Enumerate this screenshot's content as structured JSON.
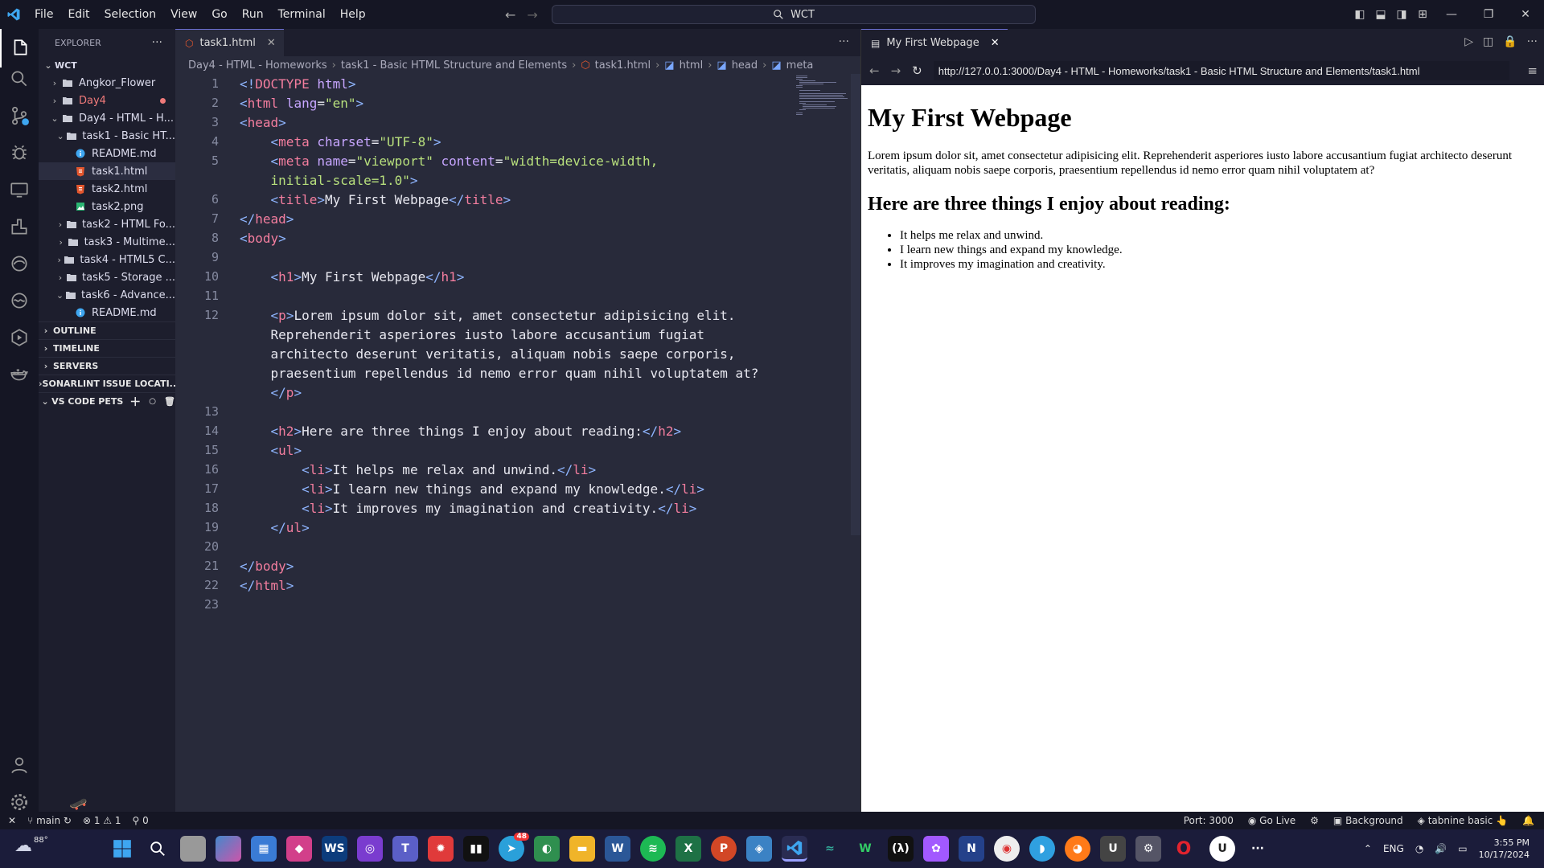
{
  "menu": [
    "File",
    "Edit",
    "Selection",
    "View",
    "Go",
    "Run",
    "Terminal",
    "Help"
  ],
  "search": {
    "text": "WCT"
  },
  "explorer": {
    "header": "EXPLORER",
    "root": "WCT",
    "items": [
      {
        "label": "Angkor_Flower",
        "indent": 1,
        "type": "folder",
        "chev": "›"
      },
      {
        "label": "Day4",
        "indent": 1,
        "type": "folder",
        "chev": "›",
        "color": "#f07a7a"
      },
      {
        "label": "Day4 - HTML - H...",
        "indent": 1,
        "type": "folder-open",
        "chev": "⌄"
      },
      {
        "label": "task1 - Basic HT...",
        "indent": 2,
        "type": "folder-open",
        "chev": "⌄"
      },
      {
        "label": "README.md",
        "indent": 3,
        "type": "info"
      },
      {
        "label": "task1.html",
        "indent": 3,
        "type": "html",
        "selected": true
      },
      {
        "label": "task2.html",
        "indent": 3,
        "type": "html"
      },
      {
        "label": "task2.png",
        "indent": 3,
        "type": "image"
      },
      {
        "label": "task2 - HTML Fo...",
        "indent": 2,
        "type": "folder",
        "chev": "›"
      },
      {
        "label": "task3 - Multime...",
        "indent": 2,
        "type": "folder",
        "chev": "›"
      },
      {
        "label": "task4 - HTML5 C...",
        "indent": 2,
        "type": "folder",
        "chev": "›"
      },
      {
        "label": "task5 - Storage ...",
        "indent": 2,
        "type": "folder",
        "chev": "›"
      },
      {
        "label": "task6 - Advance...",
        "indent": 2,
        "type": "folder-open",
        "chev": "⌄"
      },
      {
        "label": "README.md",
        "indent": 3,
        "type": "info"
      }
    ],
    "sections": [
      "OUTLINE",
      "TIMELINE",
      "SERVERS",
      "SONARLINT ISSUE LOCATI...",
      "VS CODE PETS"
    ]
  },
  "editor": {
    "tab": "task1.html",
    "breadcrumbs": [
      "Day4 - HTML - Homeworks",
      "task1 - Basic HTML Structure and Elements",
      "task1.html",
      "html",
      "head",
      "meta"
    ],
    "lines": [
      {
        "n": "1",
        "h": "<span class=b>&lt;!</span><span class=t>DOCTYPE</span> <span class=a>html</span><span class=b>&gt;</span>"
      },
      {
        "n": "2",
        "h": "<span class=b>&lt;</span><span class=t>html</span> <span class=a>lang</span>=<span class=s>\"en\"</span><span class=b>&gt;</span>"
      },
      {
        "n": "3",
        "h": "<span class=b>&lt;</span><span class=t>head</span><span class=b>&gt;</span>"
      },
      {
        "n": "4",
        "h": "    <span class=b>&lt;</span><span class=t>meta</span> <span class=a>charset</span>=<span class=s>\"UTF-8\"</span><span class=b>&gt;</span>"
      },
      {
        "n": "5",
        "h": "    <span class=b>&lt;</span><span class=t>meta</span> <span class=a>name</span>=<span class=s>\"viewport\"</span> <span class=a>content</span>=<span class=s>\"width=device-width,</span>"
      },
      {
        "n": "",
        "h": "    <span class=s>initial-scale=1.0\"</span><span class=b>&gt;</span>"
      },
      {
        "n": "6",
        "h": "    <span class=b>&lt;</span><span class=t>title</span><span class=b>&gt;</span>My First Webpage<span class=b>&lt;/</span><span class=t>title</span><span class=b>&gt;</span>"
      },
      {
        "n": "7",
        "h": "<span class=b>&lt;/</span><span class=t>head</span><span class=b>&gt;</span>"
      },
      {
        "n": "8",
        "h": "<span class=b>&lt;</span><span class=t>body</span><span class=b>&gt;</span>"
      },
      {
        "n": "9",
        "h": ""
      },
      {
        "n": "10",
        "h": "    <span class=b>&lt;</span><span class=t>h1</span><span class=b>&gt;</span>My First Webpage<span class=b>&lt;/</span><span class=t>h1</span><span class=b>&gt;</span>"
      },
      {
        "n": "11",
        "h": ""
      },
      {
        "n": "12",
        "h": "    <span class=b>&lt;</span><span class=t>p</span><span class=b>&gt;</span>Lorem ipsum dolor sit, amet consectetur adipisicing elit."
      },
      {
        "n": "",
        "h": "    Reprehenderit asperiores iusto labore accusantium fugiat"
      },
      {
        "n": "",
        "h": "    architecto deserunt veritatis, aliquam nobis saepe corporis,"
      },
      {
        "n": "",
        "h": "    praesentium repellendus id nemo error quam nihil voluptatem at?"
      },
      {
        "n": "",
        "h": "    <span class=b>&lt;/</span><span class=t>p</span><span class=b>&gt;</span>"
      },
      {
        "n": "13",
        "h": ""
      },
      {
        "n": "14",
        "h": "    <span class=b>&lt;</span><span class=t>h2</span><span class=b>&gt;</span>Here are three things I enjoy about reading:<span class=b>&lt;/</span><span class=t>h2</span><span class=b>&gt;</span>"
      },
      {
        "n": "15",
        "h": "    <span class=b>&lt;</span><span class=t>ul</span><span class=b>&gt;</span>"
      },
      {
        "n": "16",
        "h": "        <span class=b>&lt;</span><span class=t>li</span><span class=b>&gt;</span>It helps me relax and unwind.<span class=b>&lt;/</span><span class=t>li</span><span class=b>&gt;</span>"
      },
      {
        "n": "17",
        "h": "        <span class=b>&lt;</span><span class=t>li</span><span class=b>&gt;</span>I learn new things and expand my knowledge.<span class=b>&lt;/</span><span class=t>li</span><span class=b>&gt;</span>"
      },
      {
        "n": "18",
        "h": "        <span class=b>&lt;</span><span class=t>li</span><span class=b>&gt;</span>It improves my imagination and creativity.<span class=b>&lt;/</span><span class=t>li</span><span class=b>&gt;</span>"
      },
      {
        "n": "19",
        "h": "    <span class=b>&lt;/</span><span class=t>ul</span><span class=b>&gt;</span>"
      },
      {
        "n": "20",
        "h": ""
      },
      {
        "n": "21",
        "h": "<span class=b>&lt;/</span><span class=t>body</span><span class=b>&gt;</span>"
      },
      {
        "n": "22",
        "h": "<span class=b>&lt;/</span><span class=t>html</span><span class=b>&gt;</span>"
      },
      {
        "n": "23",
        "h": ""
      }
    ]
  },
  "preview": {
    "tab": "My First Webpage",
    "url": "http://127.0.0.1:3000/Day4 - HTML - Homeworks/task1 - Basic HTML Structure and Elements/task1.html",
    "h1": "My First Webpage",
    "p": "Lorem ipsum dolor sit, amet consectetur adipisicing elit. Reprehenderit asperiores iusto labore accusantium fugiat architecto deserunt veritatis, aliquam nobis saepe corporis, praesentium repellendus id nemo error quam nihil voluptatem at?",
    "h2": "Here are three things I enjoy about reading:",
    "list": [
      "It helps me relax and unwind.",
      "I learn new things and expand my knowledge.",
      "It improves my imagination and creativity."
    ]
  },
  "status": {
    "branch": "main",
    "errors": "1",
    "warnings": "1",
    "ports": "0",
    "port": "Port: 3000",
    "golive": "Go Live",
    "background": "Background",
    "tabnine": "tabnine basic"
  },
  "taskbar": {
    "weather": "88°",
    "lang": "ENG",
    "time": "3:55 PM",
    "date": "10/17/2024",
    "badge": "48"
  }
}
